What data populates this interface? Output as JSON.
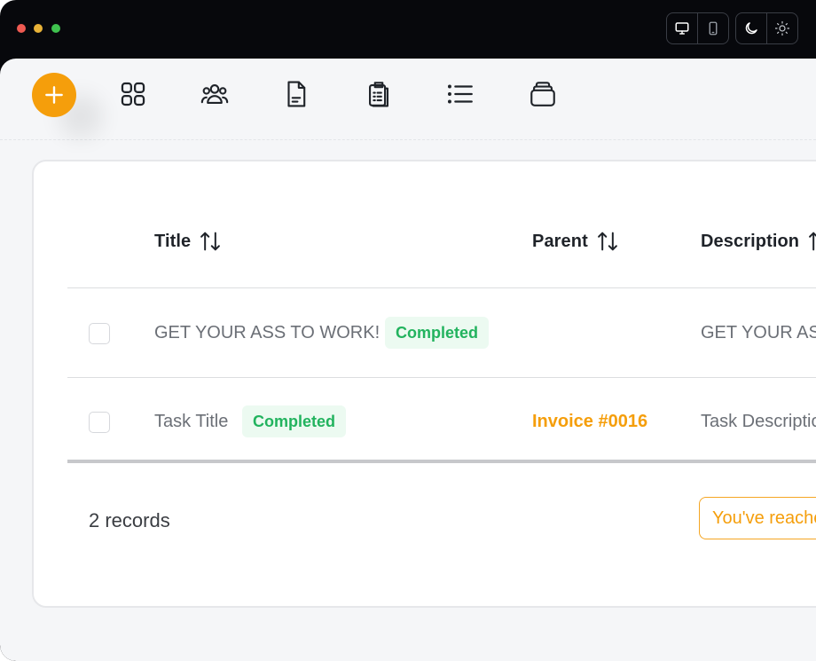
{
  "window": {
    "controls": [
      "close",
      "minimize",
      "maximize"
    ],
    "view_toggle": [
      {
        "icon": "monitor-icon",
        "active": true
      },
      {
        "icon": "phone-icon",
        "active": false
      }
    ],
    "theme_toggle": [
      {
        "icon": "moon-icon",
        "active": true
      },
      {
        "icon": "sun-icon",
        "active": false
      }
    ]
  },
  "toolbar": {
    "add_icon": "plus-icon",
    "tools": [
      "grid-icon",
      "users-icon",
      "document-icon",
      "clipboard-icon",
      "list-icon",
      "archive-icon"
    ]
  },
  "table": {
    "columns": [
      {
        "label": "Title",
        "sortable": true
      },
      {
        "label": "Parent",
        "sortable": true
      },
      {
        "label": "Description",
        "sortable": true
      }
    ],
    "rows": [
      {
        "title": "GET YOUR ASS TO WORK!",
        "status": "Completed",
        "parent": "",
        "description": "GET YOUR ASS TO WORK!"
      },
      {
        "title": "Task Title",
        "status": "Completed",
        "parent": "Invoice #0016",
        "description": "Task Description"
      }
    ]
  },
  "footer": {
    "records": "2 records",
    "notice": "You've reached the end"
  },
  "colors": {
    "accent": "#f59e0b",
    "success": "#22b35e",
    "success_bg": "#ecfaf1",
    "titlebar": "#07080c",
    "app_bg": "#f5f6f8"
  }
}
